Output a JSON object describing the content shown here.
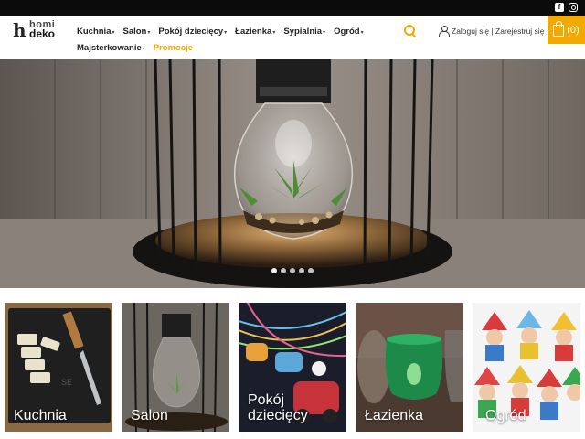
{
  "brand": {
    "logo_line1": "homi",
    "logo_line2": "deko"
  },
  "topbar": {
    "social": [
      "facebook-icon",
      "instagram-icon"
    ]
  },
  "nav": {
    "items": [
      {
        "label": "Kuchnia",
        "dropdown": true
      },
      {
        "label": "Salon",
        "dropdown": true
      },
      {
        "label": "Pokój dziecięcy",
        "dropdown": true
      },
      {
        "label": "Łazienka",
        "dropdown": true
      },
      {
        "label": "Sypialnia",
        "dropdown": true
      },
      {
        "label": "Ogród",
        "dropdown": true
      },
      {
        "label": "Majsterkowanie",
        "dropdown": true
      },
      {
        "label": "Promocje",
        "dropdown": false
      }
    ]
  },
  "account": {
    "text": "Zaloguj się | Zarejestruj się"
  },
  "cart": {
    "count": "(0)"
  },
  "hero": {
    "slides_count": 5,
    "active_slide": 1
  },
  "categories": [
    {
      "label": "Kuchnia"
    },
    {
      "label": "Salon"
    },
    {
      "label": "Pokój dziecięcy"
    },
    {
      "label": "Łazienka"
    },
    {
      "label": "Ogród"
    }
  ],
  "colors": {
    "accent": "#f2a900",
    "topbar": "#0b0b0b",
    "text": "#222222"
  }
}
